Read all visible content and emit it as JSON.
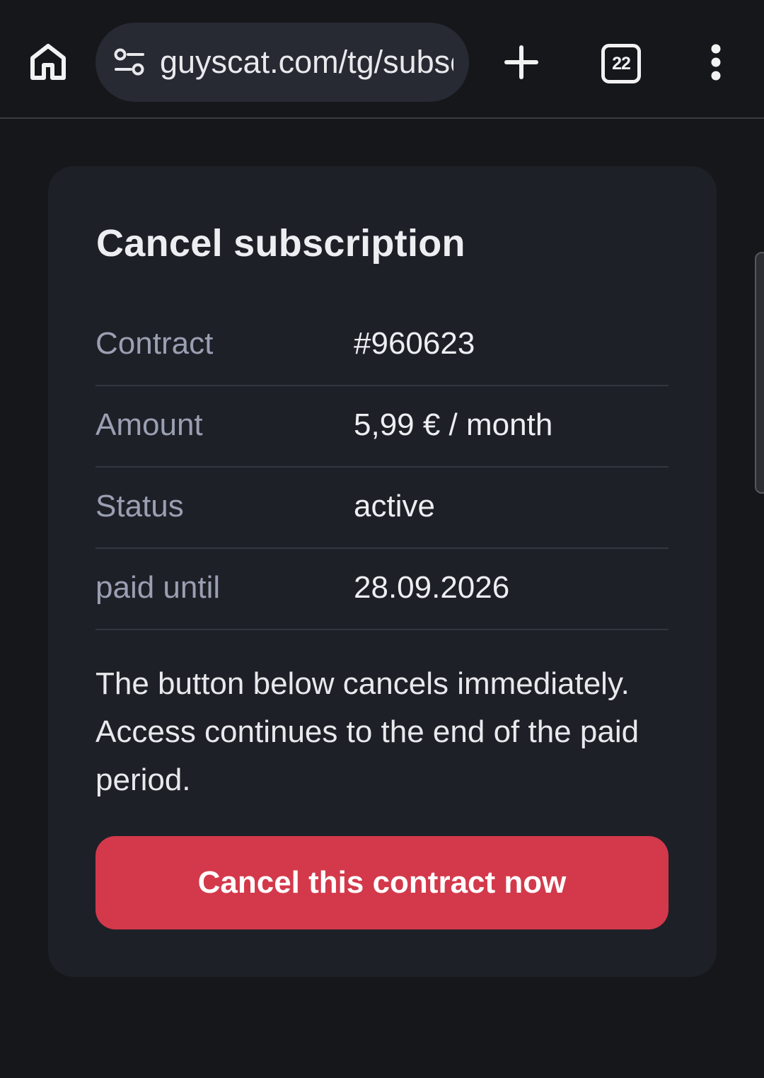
{
  "browser": {
    "url": "guyscat.com/tg/subscription",
    "tab_count": "22",
    "icons": {
      "home": "home-icon",
      "site_info": "site-settings-icon",
      "new_tab": "plus-icon",
      "tabs": "tab-switcher-icon",
      "menu": "more-vert-icon"
    }
  },
  "card": {
    "title": "Cancel subscription",
    "details": [
      {
        "label": "Contract",
        "value": "#960623"
      },
      {
        "label": "Amount",
        "value": "5,99 € / month"
      },
      {
        "label": "Status",
        "value": "active"
      },
      {
        "label": "paid until",
        "value": "28.09.2026"
      }
    ],
    "notice": "The button below cancels immediately. Access continues to the end of the paid period.",
    "cancel_button_label": "Cancel this contract now"
  },
  "colors": {
    "background": "#16171b",
    "card": "#1e2027",
    "danger": "#d3394b",
    "label": "#9a9fb2",
    "text": "#eceef2"
  }
}
